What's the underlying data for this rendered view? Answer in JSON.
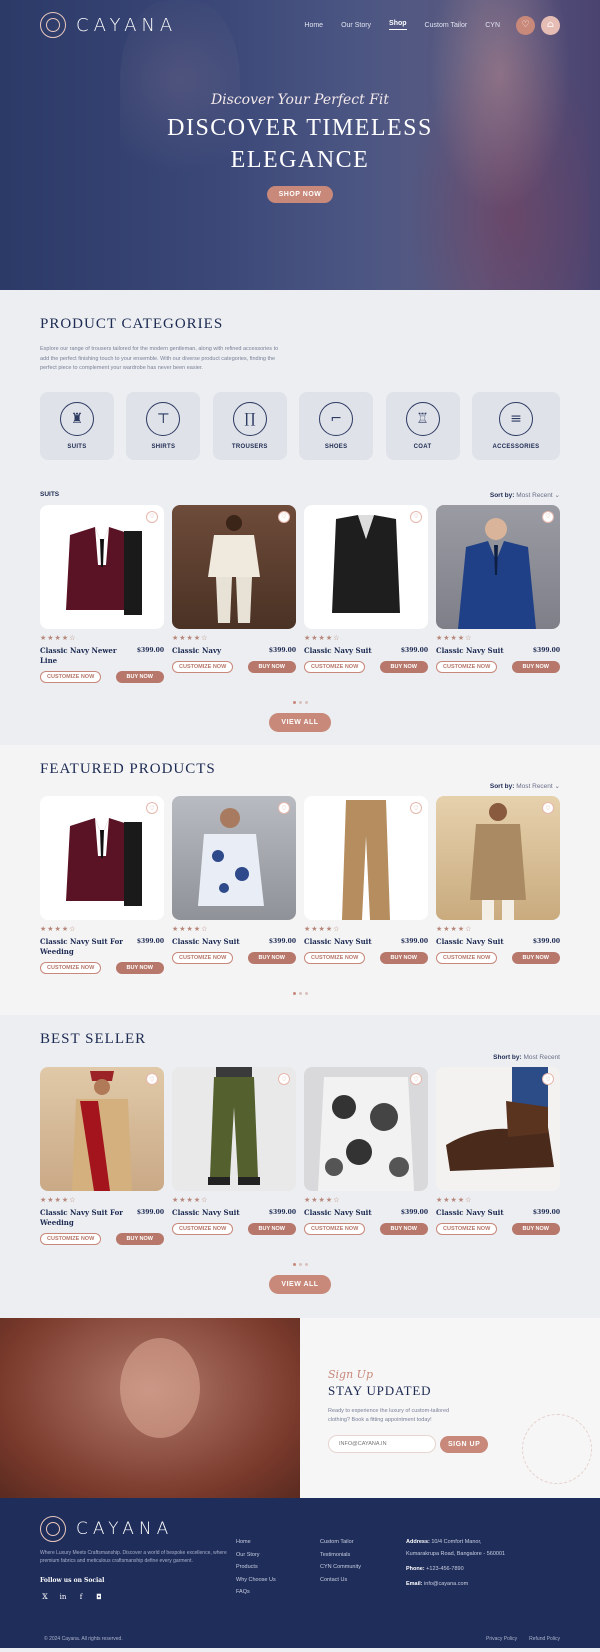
{
  "brand": {
    "name": "CAYANA"
  },
  "nav": {
    "items": [
      "Home",
      "Our Story",
      "Shop",
      "Custom Tailor",
      "CYN"
    ],
    "active_index": 2
  },
  "hero": {
    "script": "Discover Your Perfect Fit",
    "title_line1": "DISCOVER TIMELESS",
    "title_line2": "ELEGANCE",
    "cta": "SHOP NOW"
  },
  "categories": {
    "title": "PRODUCT CATEGORIES",
    "description": "Explore our range of trousers tailored for the modern gentleman, along with refined accessories to add the perfect finishing touch to your ensemble. With our diverse product categories, finding the perfect piece to complement your wardrobe has never been easier.",
    "items": [
      {
        "label": "SUITS",
        "icon": "suit-icon"
      },
      {
        "label": "SHIRTS",
        "icon": "shirt-icon"
      },
      {
        "label": "TROUSERS",
        "icon": "trousers-icon"
      },
      {
        "label": "SHOES",
        "icon": "shoe-icon"
      },
      {
        "label": "COAT",
        "icon": "coat-icon"
      },
      {
        "label": "ACCESSORIES",
        "icon": "accessories-icon"
      }
    ]
  },
  "common": {
    "customize": "CUSTOMIZE NOW",
    "buy": "BUY NOW",
    "view_all": "VIEW ALL",
    "rating": "★★★★☆"
  },
  "suits_row": {
    "label": "SUITS",
    "sort_label": "Sort by:",
    "sort_value": "Most Recent",
    "products": [
      {
        "name": "Classic Navy Newer Line",
        "price": "$399.00"
      },
      {
        "name": "Classic Navy",
        "price": "$399.00"
      },
      {
        "name": "Classic Navy Suit",
        "price": "$399.00"
      },
      {
        "name": "Classic Navy Suit",
        "price": "$399.00"
      }
    ]
  },
  "featured": {
    "title": "FEATURED PRODUCTS",
    "sort_label": "Sort by:",
    "sort_value": "Most Recent",
    "products": [
      {
        "name": "Classic Navy Suit For Weeding",
        "price": "$399.00"
      },
      {
        "name": "Classic Navy Suit",
        "price": "$399.00"
      },
      {
        "name": "Classic Navy Suit",
        "price": "$399.00"
      },
      {
        "name": "Classic Navy Suit",
        "price": "$399.00"
      }
    ]
  },
  "best": {
    "title": "BEST SELLER",
    "sort_label": "Short by:",
    "sort_value": "Most Recent",
    "products": [
      {
        "name": "Classic Navy Suit For Weeding",
        "price": "$399.00"
      },
      {
        "name": "Classic Navy Suit",
        "price": "$399.00"
      },
      {
        "name": "Classic Navy Suit",
        "price": "$399.00"
      },
      {
        "name": "Classic Navy Suit",
        "price": "$399.00"
      }
    ]
  },
  "newsletter": {
    "script": "Sign Up",
    "title": "STAY UPDATED",
    "description": "Ready to experience the luxury of custom-tailored clothing? Book a fitting appointment today!",
    "placeholder": "INFO@CAYANA.IN",
    "button": "SIGN UP"
  },
  "footer": {
    "description": "Where Luxury Meets Craftsmanship. Discover a world of bespoke excellence, where premium fabrics and meticulous craftsmanship define every garment.",
    "follow": "Follow us on Social",
    "col1": [
      "Home",
      "Our Story",
      "Products",
      "Why Choose Us",
      "FAQs"
    ],
    "col2": [
      "Custom Tailor",
      "Testimonials",
      "CYN Community",
      "Contact Us"
    ],
    "address_label": "Address:",
    "address_line1": "10/4 Comfort Manor,",
    "address_line2": "Kumarakrupa Road, Bangalore - 560001",
    "phone_label": "Phone:",
    "phone": "+123-456-7890",
    "email_label": "Email:",
    "email": "info@cayana.com",
    "copyright": "© 2024 Cayana. All rights reserved.",
    "privacy": "Privacy Policy",
    "refund": "Refund Policy"
  }
}
